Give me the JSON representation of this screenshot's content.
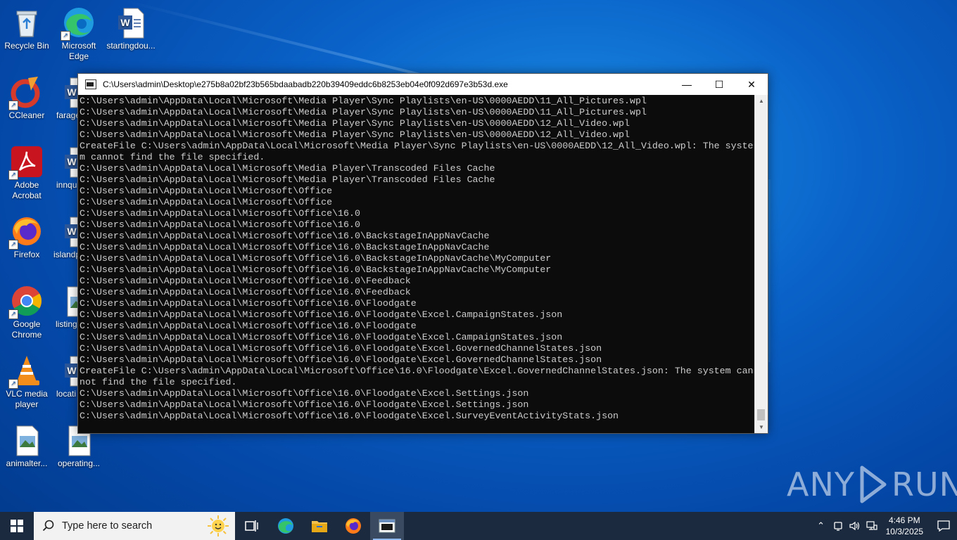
{
  "desktop": {
    "icons": [
      {
        "label": "Recycle Bin"
      },
      {
        "label": "Microsoft Edge"
      },
      {
        "label": "startingdou..."
      },
      {
        "label": "CCleaner"
      },
      {
        "label": "farage"
      },
      {
        "label": "Adobe Acrobat"
      },
      {
        "label": "innqu"
      },
      {
        "label": "Firefox"
      },
      {
        "label": "islandp"
      },
      {
        "label": "Google Chrome"
      },
      {
        "label": "listing"
      },
      {
        "label": "VLC media player"
      },
      {
        "label": "locati"
      },
      {
        "label": "animalter..."
      },
      {
        "label": "operating..."
      }
    ]
  },
  "window": {
    "title": "C:\\Users\\admin\\Desktop\\e275b8a02bf23b565bdaabadb220b39409eddc6b8253eb04e0f092d697e3b53d.exe",
    "minimize": "—",
    "maximize": "☐",
    "close": "✕",
    "console_lines": [
      "C:\\Users\\admin\\AppData\\Local\\Microsoft\\Media Player\\Sync Playlists\\en-US\\0000AEDD\\11_All_Pictures.wpl",
      "C:\\Users\\admin\\AppData\\Local\\Microsoft\\Media Player\\Sync Playlists\\en-US\\0000AEDD\\11_All_Pictures.wpl",
      "C:\\Users\\admin\\AppData\\Local\\Microsoft\\Media Player\\Sync Playlists\\en-US\\0000AEDD\\12_All_Video.wpl",
      "C:\\Users\\admin\\AppData\\Local\\Microsoft\\Media Player\\Sync Playlists\\en-US\\0000AEDD\\12_All_Video.wpl",
      "CreateFile C:\\Users\\admin\\AppData\\Local\\Microsoft\\Media Player\\Sync Playlists\\en-US\\0000AEDD\\12_All_Video.wpl: The syste",
      "m cannot find the file specified.",
      "C:\\Users\\admin\\AppData\\Local\\Microsoft\\Media Player\\Transcoded Files Cache",
      "C:\\Users\\admin\\AppData\\Local\\Microsoft\\Media Player\\Transcoded Files Cache",
      "C:\\Users\\admin\\AppData\\Local\\Microsoft\\Office",
      "C:\\Users\\admin\\AppData\\Local\\Microsoft\\Office",
      "C:\\Users\\admin\\AppData\\Local\\Microsoft\\Office\\16.0",
      "C:\\Users\\admin\\AppData\\Local\\Microsoft\\Office\\16.0",
      "C:\\Users\\admin\\AppData\\Local\\Microsoft\\Office\\16.0\\BackstageInAppNavCache",
      "C:\\Users\\admin\\AppData\\Local\\Microsoft\\Office\\16.0\\BackstageInAppNavCache",
      "C:\\Users\\admin\\AppData\\Local\\Microsoft\\Office\\16.0\\BackstageInAppNavCache\\MyComputer",
      "C:\\Users\\admin\\AppData\\Local\\Microsoft\\Office\\16.0\\BackstageInAppNavCache\\MyComputer",
      "C:\\Users\\admin\\AppData\\Local\\Microsoft\\Office\\16.0\\Feedback",
      "C:\\Users\\admin\\AppData\\Local\\Microsoft\\Office\\16.0\\Feedback",
      "C:\\Users\\admin\\AppData\\Local\\Microsoft\\Office\\16.0\\Floodgate",
      "C:\\Users\\admin\\AppData\\Local\\Microsoft\\Office\\16.0\\Floodgate\\Excel.CampaignStates.json",
      "C:\\Users\\admin\\AppData\\Local\\Microsoft\\Office\\16.0\\Floodgate",
      "C:\\Users\\admin\\AppData\\Local\\Microsoft\\Office\\16.0\\Floodgate\\Excel.CampaignStates.json",
      "C:\\Users\\admin\\AppData\\Local\\Microsoft\\Office\\16.0\\Floodgate\\Excel.GovernedChannelStates.json",
      "C:\\Users\\admin\\AppData\\Local\\Microsoft\\Office\\16.0\\Floodgate\\Excel.GovernedChannelStates.json",
      "CreateFile C:\\Users\\admin\\AppData\\Local\\Microsoft\\Office\\16.0\\Floodgate\\Excel.GovernedChannelStates.json: The system can",
      "not find the file specified.",
      "C:\\Users\\admin\\AppData\\Local\\Microsoft\\Office\\16.0\\Floodgate\\Excel.Settings.json",
      "C:\\Users\\admin\\AppData\\Local\\Microsoft\\Office\\16.0\\Floodgate\\Excel.Settings.json",
      "C:\\Users\\admin\\AppData\\Local\\Microsoft\\Office\\16.0\\Floodgate\\Excel.SurveyEventActivityStats.json"
    ]
  },
  "watermark": {
    "left": "ANY",
    "right": "RUN"
  },
  "taskbar": {
    "search_placeholder": "Type here to search",
    "time": "4:46 PM",
    "date": "10/3/2025"
  },
  "colors": {
    "console_bg": "#0c0c0c",
    "console_text": "#cccccc",
    "taskbar_bg": "#1b2a3e"
  }
}
